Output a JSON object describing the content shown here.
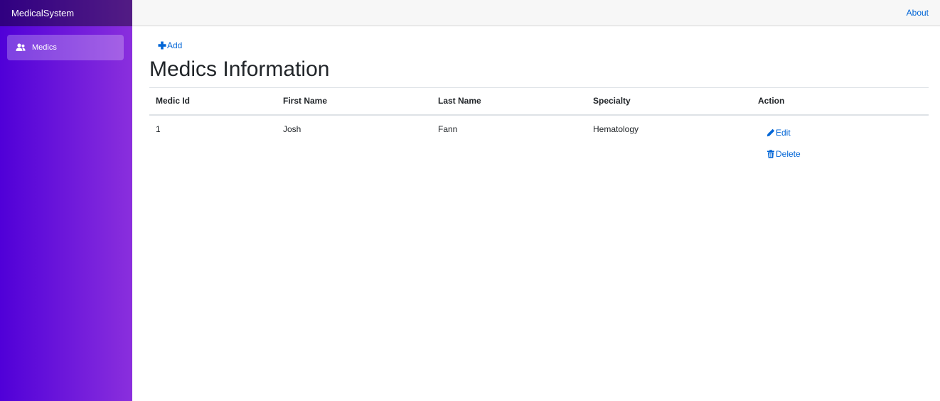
{
  "app": {
    "brand": "MedicalSystem"
  },
  "sidebar": {
    "items": [
      {
        "label": "Medics",
        "icon": "users-icon"
      }
    ]
  },
  "header": {
    "about_label": "About"
  },
  "main": {
    "add_label": "Add",
    "title": "Medics Information",
    "table": {
      "columns": [
        "Medic Id",
        "First Name",
        "Last Name",
        "Specialty",
        "Action"
      ],
      "rows": [
        {
          "id": "1",
          "first_name": "Josh",
          "last_name": "Fann",
          "specialty": "Hematology",
          "edit_label": "Edit",
          "delete_label": "Delete"
        }
      ]
    }
  },
  "colors": {
    "sidebar_gradient_start": "#5000d8",
    "sidebar_gradient_end": "#8a2fdd",
    "link": "#0366d6"
  }
}
